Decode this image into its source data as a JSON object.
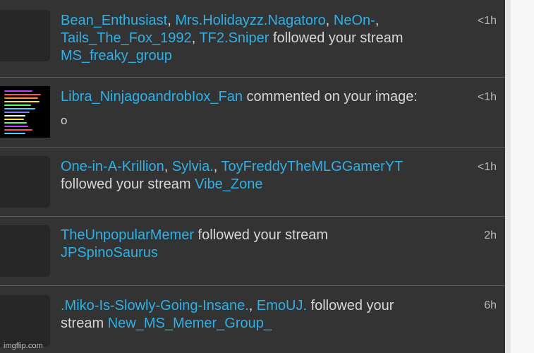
{
  "notifications": [
    {
      "users": [
        "Bean_Enthusiast",
        "Mrs.Holidayzz.Nagatoro",
        "NeOn-",
        "Tails_The_Fox_1992",
        "TF2.Sniper"
      ],
      "action": "followed your stream",
      "stream": "MS_freaky_group",
      "time": "<1h"
    },
    {
      "user": "Libra_NinjagoandrobIox_Fan",
      "action": "commented on your image:",
      "comment": "o",
      "time": "<1h"
    },
    {
      "users": [
        "One-in-A-Krillion",
        "Sylvia.",
        "ToyFreddyTheMLGGamerYT"
      ],
      "action": "followed your stream",
      "stream": "Vibe_Zone",
      "time": "<1h"
    },
    {
      "user": "TheUnpopularMemer",
      "action": "followed your stream",
      "stream": "JPSpinoSaurus",
      "time": "2h"
    },
    {
      "users": [
        ".Miko-Is-Slowly-Going-Insane.",
        "EmoUJ."
      ],
      "action_part1": "followed your",
      "action_part2": "stream",
      "stream": "New_MS_Memer_Group_",
      "time": "6h"
    }
  ],
  "punctuation": {
    "comma": ", "
  },
  "watermark": "imgflip.com",
  "colors": {
    "link": "#2fb0e6",
    "text": "#d6d6d6",
    "background": "#333333"
  }
}
